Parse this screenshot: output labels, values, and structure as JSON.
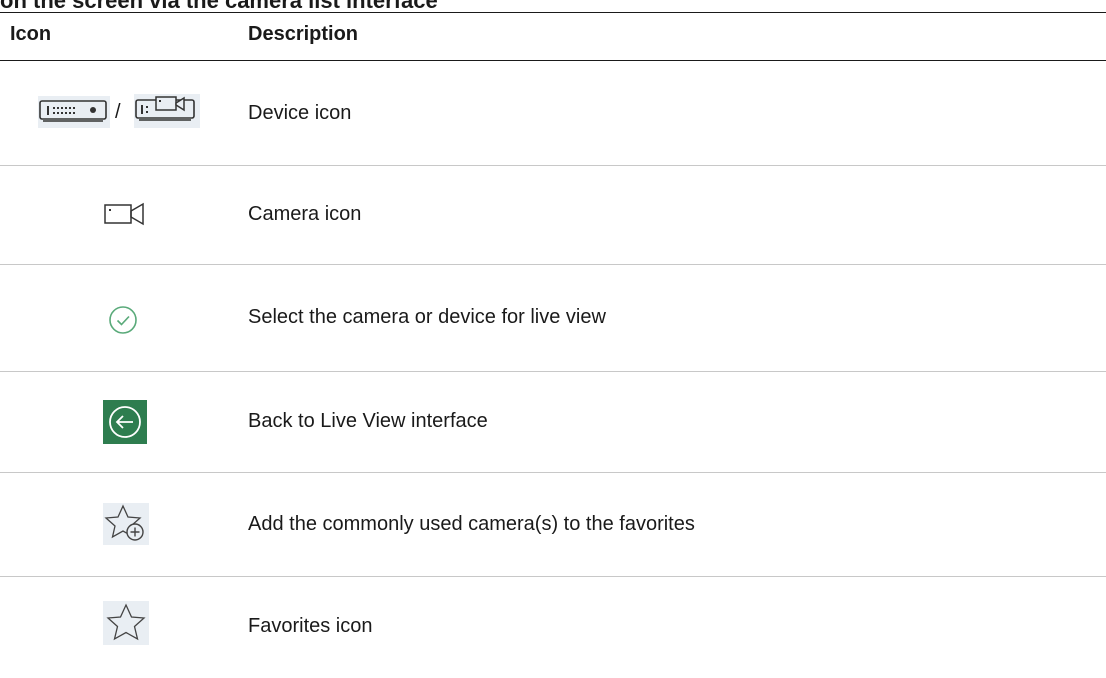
{
  "caption": "on the screen via the camera list interface",
  "table": {
    "headers": {
      "icon": "Icon",
      "description": "Description"
    },
    "rows": [
      {
        "icon": "device-icon",
        "description": "Device icon",
        "separator": "/"
      },
      {
        "icon": "camera-icon",
        "description": "Camera icon"
      },
      {
        "icon": "select-check-icon",
        "description": "Select the camera or device for live view"
      },
      {
        "icon": "back-arrow-icon",
        "description": "Back to Live View interface"
      },
      {
        "icon": "add-favorite-star-icon",
        "description": "Add the commonly used camera(s) to the favorites"
      },
      {
        "icon": "favorites-star-icon",
        "description": "Favorites icon"
      }
    ]
  },
  "colors": {
    "accent_green": "#2e7d4f",
    "check_green": "#5aaa7a",
    "icon_bg": "#e9eef3",
    "rule": "#1a1a1a",
    "row_divider": "#c8c8c8"
  }
}
